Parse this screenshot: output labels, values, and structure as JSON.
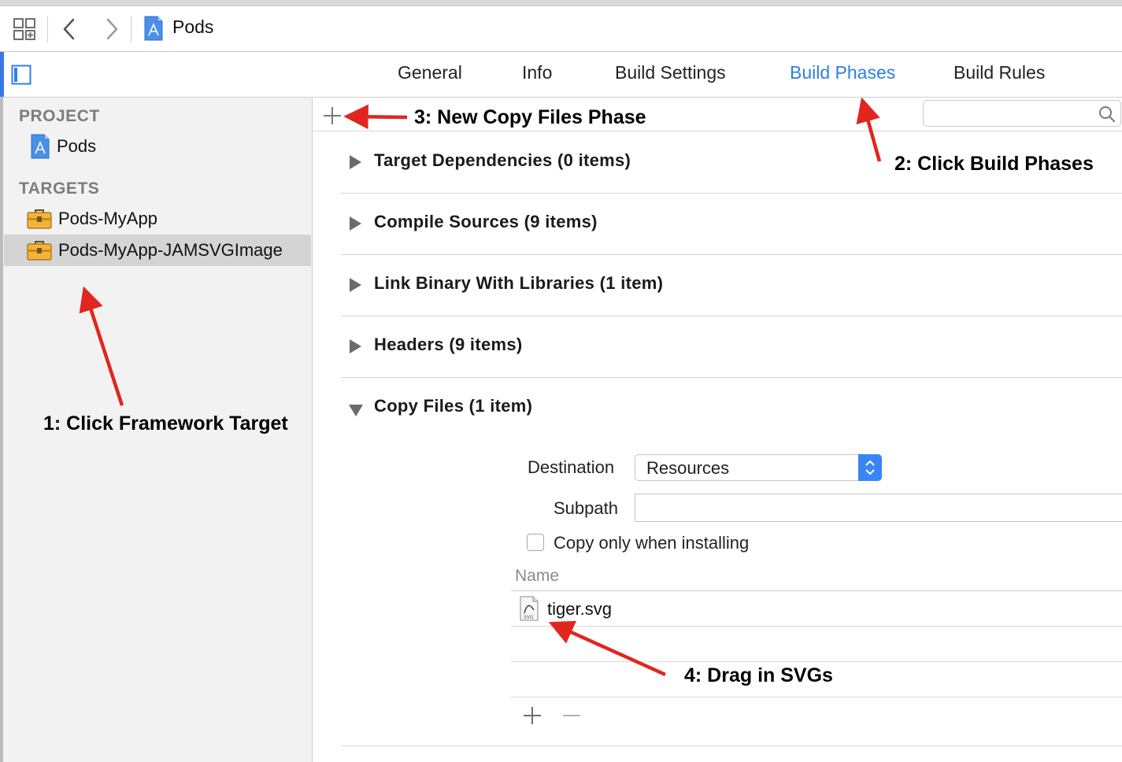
{
  "toolbar": {
    "project_name": "Pods"
  },
  "tabs": [
    {
      "label": "General",
      "active": false
    },
    {
      "label": "Info",
      "active": false
    },
    {
      "label": "Build Settings",
      "active": false
    },
    {
      "label": "Build Phases",
      "active": true
    },
    {
      "label": "Build Rules",
      "active": false
    }
  ],
  "sidebar": {
    "project_header": "PROJECT",
    "project_item": "Pods",
    "targets_header": "TARGETS",
    "targets": [
      {
        "label": "Pods-MyApp",
        "selected": false
      },
      {
        "label": "Pods-MyApp-JAMSVGImage",
        "selected": true
      }
    ]
  },
  "phases": [
    {
      "title": "Target Dependencies (0 items)",
      "expanded": false
    },
    {
      "title": "Compile Sources (9 items)",
      "expanded": false
    },
    {
      "title": "Link Binary With Libraries (1 item)",
      "expanded": false
    },
    {
      "title": "Headers (9 items)",
      "expanded": false
    },
    {
      "title": "Copy Files (1 item)",
      "expanded": true
    }
  ],
  "copy_files": {
    "destination_label": "Destination",
    "destination_value": "Resources",
    "subpath_label": "Subpath",
    "subpath_value": "",
    "copy_only_label": "Copy only when installing",
    "copy_only_checked": false,
    "name_header": "Name",
    "files": [
      "tiger.svg"
    ]
  },
  "annotations": {
    "step1": "1: Click Framework Target",
    "step2": "2: Click Build Phases",
    "step3": "3: New Copy Files Phase",
    "step4": "4: Drag in SVGs"
  },
  "colors": {
    "accent": "#2f7ee8",
    "selection": "#d4d4d4",
    "arrow": "#e0261e",
    "stepper": "#3a85f5"
  },
  "icons": {
    "toolbar": [
      "grid-icon",
      "back-chevron-icon",
      "forward-chevron-icon",
      "project-file-icon"
    ],
    "sidebar": [
      "panel-toggle-icon",
      "project-file-icon",
      "target-toolbox-icon"
    ],
    "phases": [
      "add-icon",
      "search-icon",
      "svg-file-icon",
      "remove-icon"
    ]
  }
}
